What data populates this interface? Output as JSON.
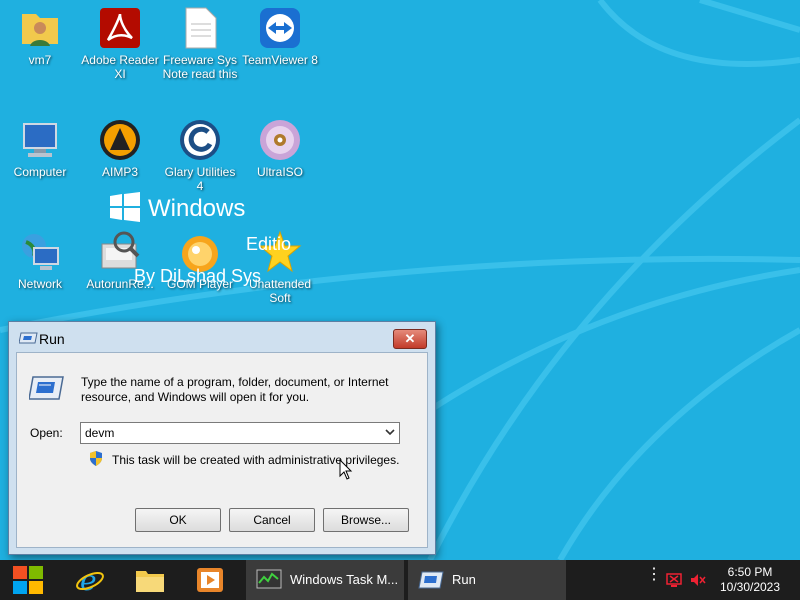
{
  "desktop": {
    "icons": [
      {
        "label": "vm7",
        "icon": "user-folder-icon"
      },
      {
        "label": "Adobe Reader\nXI",
        "icon": "adobe-reader-icon"
      },
      {
        "label": "Freeware Sys\nNote read this",
        "icon": "text-document-icon"
      },
      {
        "label": "TeamViewer 8",
        "icon": "teamviewer-icon"
      },
      {
        "label": "Computer",
        "icon": "computer-icon"
      },
      {
        "label": "AIMP3",
        "icon": "aimp-icon"
      },
      {
        "label": "Glary Utilities\n4",
        "icon": "glary-utilities-icon"
      },
      {
        "label": "UltraISO",
        "icon": "disc-icon"
      },
      {
        "label": "Network",
        "icon": "network-icon"
      },
      {
        "label": "AutorunRe...",
        "icon": "autorun-icon"
      },
      {
        "label": "GOM Player",
        "icon": "gom-player-icon"
      },
      {
        "label": "Unattended\nSoft",
        "icon": "star-icon"
      }
    ],
    "branding": {
      "windows": "Windows",
      "edition": "Editio",
      "by": "By DiLshad Sys"
    }
  },
  "run_dialog": {
    "title": "Run",
    "close": "✕",
    "description": "Type the name of a program, folder, document, or Internet resource, and Windows will open it for you.",
    "open_label": "Open:",
    "open_value": "devm",
    "admin_note": "This task will be created with administrative privileges.",
    "buttons": {
      "ok": "OK",
      "cancel": "Cancel",
      "browse": "Browse..."
    }
  },
  "taskbar": {
    "pinned": [
      "start-icon",
      "internet-explorer-icon",
      "file-explorer-icon",
      "media-player-icon"
    ],
    "tasks": [
      {
        "label": "Windows Task M...",
        "icon": "task-manager-icon"
      },
      {
        "label": "Run",
        "icon": "run-icon"
      }
    ],
    "tray": {
      "more": "⋮"
    },
    "clock": {
      "time": "6:50 PM",
      "date": "10/30/2023"
    }
  },
  "colors": {
    "desktop_bg": "#1fb0e0",
    "taskbar_bg": "#1d1d1d",
    "dialog_frame": "#cfe0ef",
    "close_red": "#c23b2a"
  }
}
